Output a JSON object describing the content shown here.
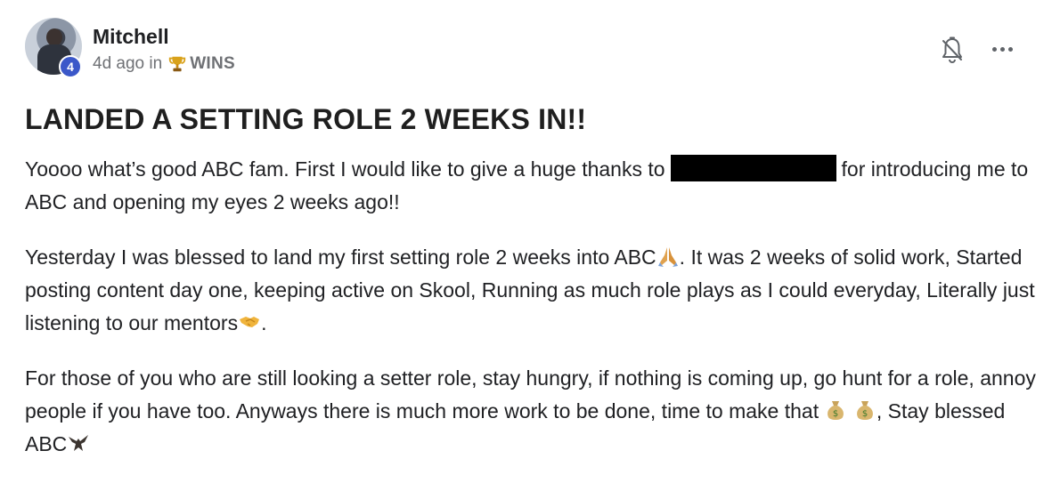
{
  "post": {
    "author_name": "Mitchell",
    "level": "4",
    "time_ago": "4d ago in",
    "category": "WINS",
    "title": "LANDED A SETTING ROLE 2 WEEKS IN!!",
    "p1_a": "Yoooo what’s good ABC fam. First I would like to give a huge thanks to",
    "p1_b": "for introducing me to ABC and opening my eyes 2 weeks ago!!",
    "p2_a": "Yesterday I was blessed to land my first setting role 2 weeks into ABC",
    "p2_b": ". It was 2 weeks of solid work, Started posting content day one, keeping active on Skool, Running as much role plays as I could everyday, Literally just listening to our mentors",
    "p2_c": ".",
    "p3_a": "For those of you who are still looking a setter role, stay hungry, if nothing is coming up, go hunt for a role, annoy people if you have too. Anyways there is much more work to be done, time to make that",
    "p3_b": ", Stay blessed ABC"
  },
  "icons": {
    "trophy": "trophy-icon",
    "bell": "bell-off-icon",
    "more": "more-horizontal-icon",
    "pray": "folded-hands-emoji",
    "handshake": "handshake-emoji",
    "money": "money-bag-emoji",
    "eagle": "eagle-emoji"
  },
  "colors": {
    "badge": "#3b58c9",
    "meta_text": "#6f7175",
    "redaction": "#000000"
  }
}
